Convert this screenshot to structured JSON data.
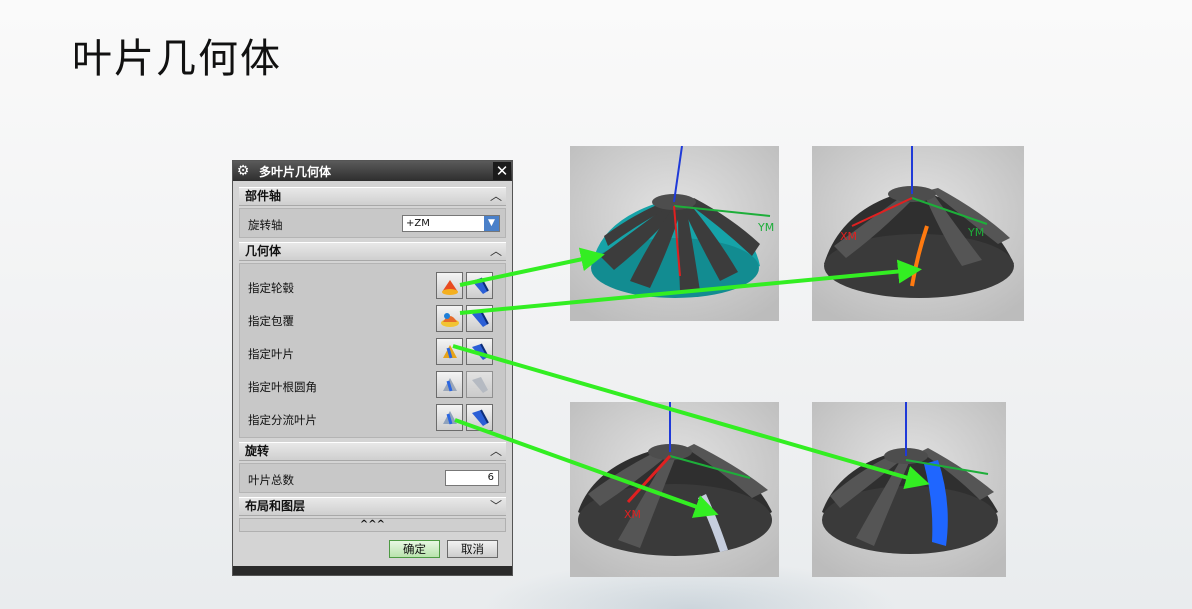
{
  "slide": {
    "title": "叶片几何体"
  },
  "dialog": {
    "title": "多叶片几何体",
    "sections": {
      "part_axis": {
        "header": "部件轴",
        "rotation_label": "旋转轴",
        "rotation_value": "+ZM"
      },
      "geometry": {
        "header": "几何体",
        "rows": [
          {
            "label": "指定轮毂"
          },
          {
            "label": "指定包覆"
          },
          {
            "label": "指定叶片"
          },
          {
            "label": "指定叶根圆角"
          },
          {
            "label": "指定分流叶片"
          }
        ]
      },
      "rotation": {
        "header": "旋转",
        "blade_count_label": "叶片总数",
        "blade_count_value": "6"
      },
      "layout": {
        "header": "布局和图层"
      }
    },
    "expander": "^^^",
    "ok_label": "确定",
    "cancel_label": "取消"
  },
  "renders": {
    "top_left": {
      "axis_label": "YM"
    },
    "top_right": {
      "axis_labels": [
        "XM",
        "YM"
      ]
    },
    "bottom_left": {
      "axis_label": "XM"
    },
    "bottom_right": {
      "axis_label": ""
    }
  },
  "colors": {
    "arrow": "#33ee22",
    "hub": "#16a3a8",
    "accent_blue": "#1f66ff",
    "orange": "#ff7a10"
  }
}
